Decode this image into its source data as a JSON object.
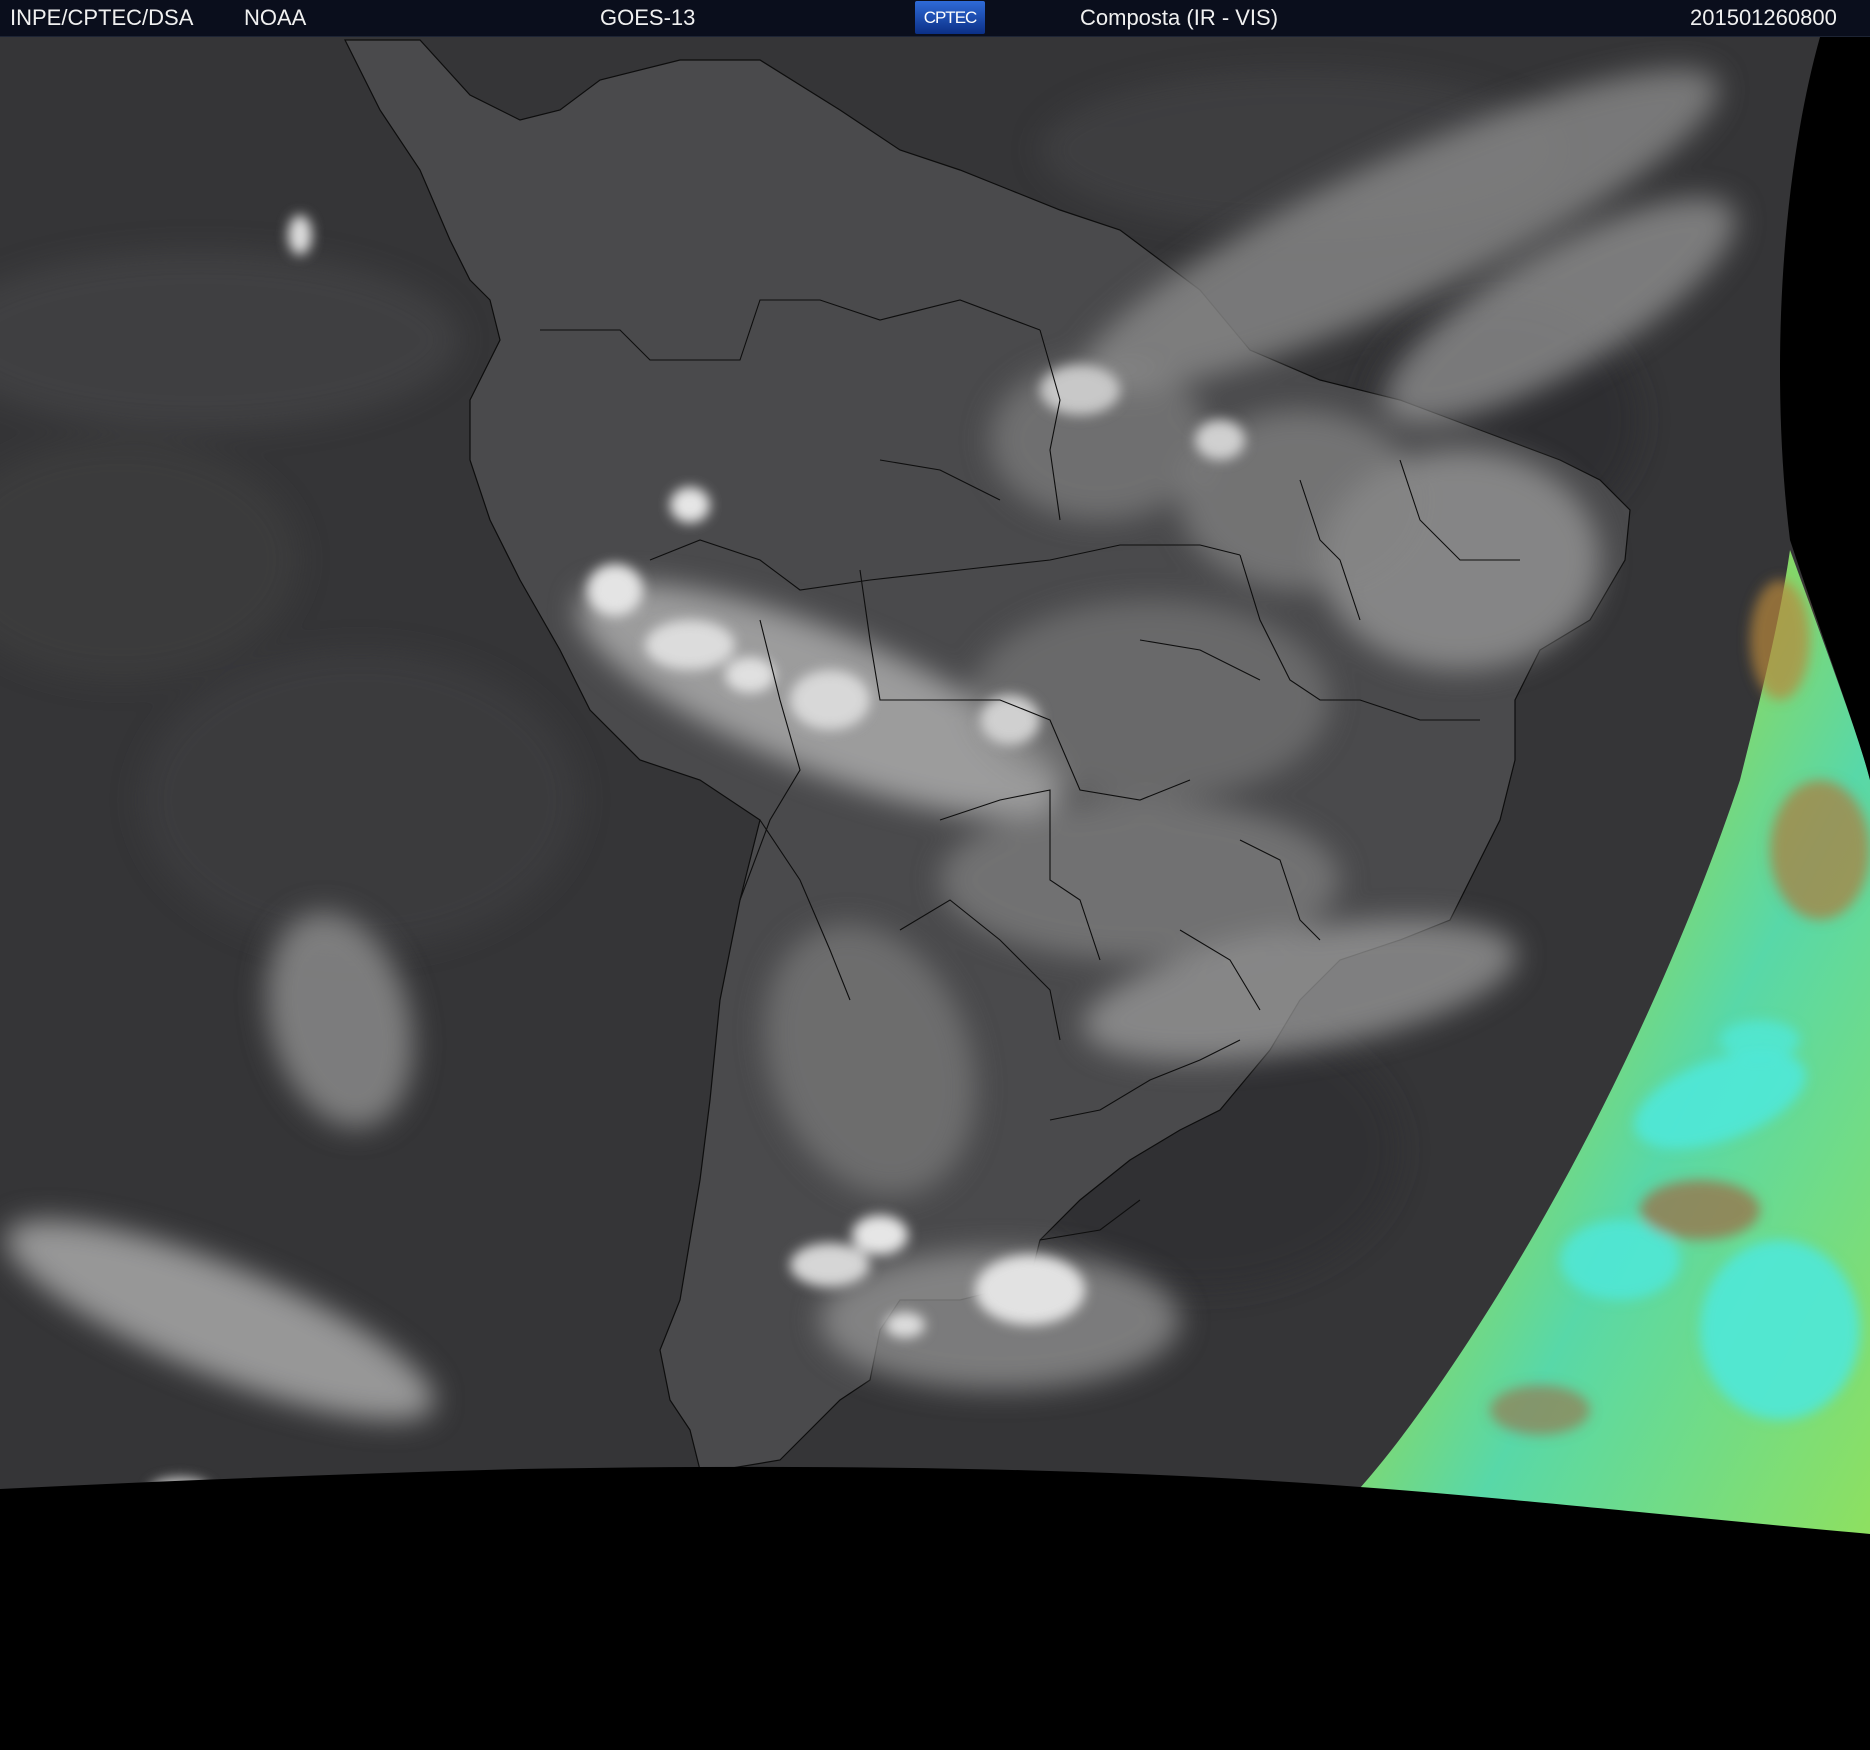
{
  "header": {
    "agency": "INPE/CPTEC/DSA",
    "partner": "NOAA",
    "satellite": "GOES-13",
    "logo_text": "CPTEC",
    "product": "Composta (IR - VIS)",
    "timestamp": "201501260800"
  },
  "colors": {
    "header_bg": "#0a0e1c",
    "ocean": "#3a3a3c",
    "land": "#4a4a4c",
    "cloud": "#d8d8d8",
    "vis_sector_green": "#9ad84c",
    "vis_sector_cyan": "#4fe8d8",
    "vis_sector_brown": "#a86c3c",
    "border_lines": "#111111",
    "space": "#000000"
  }
}
